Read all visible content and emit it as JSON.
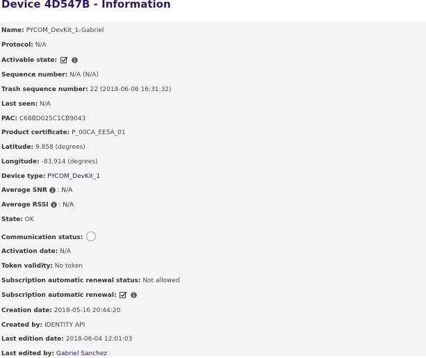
{
  "page": {
    "title": "Device 4D547B - Information"
  },
  "fields": {
    "name": {
      "label": "Name:",
      "value": "PYCOM_DevKit_1-Gabriel"
    },
    "protocol": {
      "label": "Protocol:",
      "value": "N/A"
    },
    "activable": {
      "label": "Activable state:"
    },
    "sequence": {
      "label": "Sequence number:",
      "value": "N/A (N/A)"
    },
    "trash_seq": {
      "label": "Trash sequence number:",
      "value": "22 (2018-06-06 16:31:32)"
    },
    "last_seen": {
      "label": "Last seen:",
      "value": "N/A"
    },
    "pac": {
      "label": "PAC:",
      "value": "C68BD025C1CB9043"
    },
    "certificate": {
      "label": "Product certificate:",
      "value": "P_00CA_EE5A_01"
    },
    "latitude": {
      "label": "Latitude:",
      "value": "9.858 (degrees)"
    },
    "longitude": {
      "label": "Longitude:",
      "value": "-83.914 (degrees)"
    },
    "device_type": {
      "label": "Device type:",
      "value": "PYCOM_DevKit_1"
    },
    "avg_snr": {
      "label": "Average SNR",
      "value": ": N/A"
    },
    "avg_rssi": {
      "label": "Average RSSI",
      "value": ": N/A"
    },
    "state": {
      "label": "State:",
      "value": "OK"
    },
    "comm_status": {
      "label": "Communication status:"
    },
    "activation_date": {
      "label": "Activation date:",
      "value": "N/A"
    },
    "token": {
      "label": "Token validity:",
      "value": "No token"
    },
    "renewal_status": {
      "label": "Subscription automatic renewal status:",
      "value": "Not allowed"
    },
    "renewal": {
      "label": "Subscription automatic renewal:"
    },
    "created": {
      "label": "Creation date:",
      "value": "2018-05-16 20:44:20"
    },
    "created_by": {
      "label": "Created by:",
      "value": "IDENTITY API"
    },
    "last_edit": {
      "label": "Last edition date:",
      "value": "2018-06-04 12:01:03"
    },
    "last_edited_by": {
      "label": "Last edited by:",
      "value": "Gabriel Sanchez"
    }
  },
  "icons": {
    "checked": "checkbox-checked-icon",
    "info": "info-circle-icon",
    "status": "status-circle-icon"
  },
  "colors": {
    "title": "#2b1a63",
    "link": "#2b1a63",
    "panel": "#f5f5f5"
  }
}
